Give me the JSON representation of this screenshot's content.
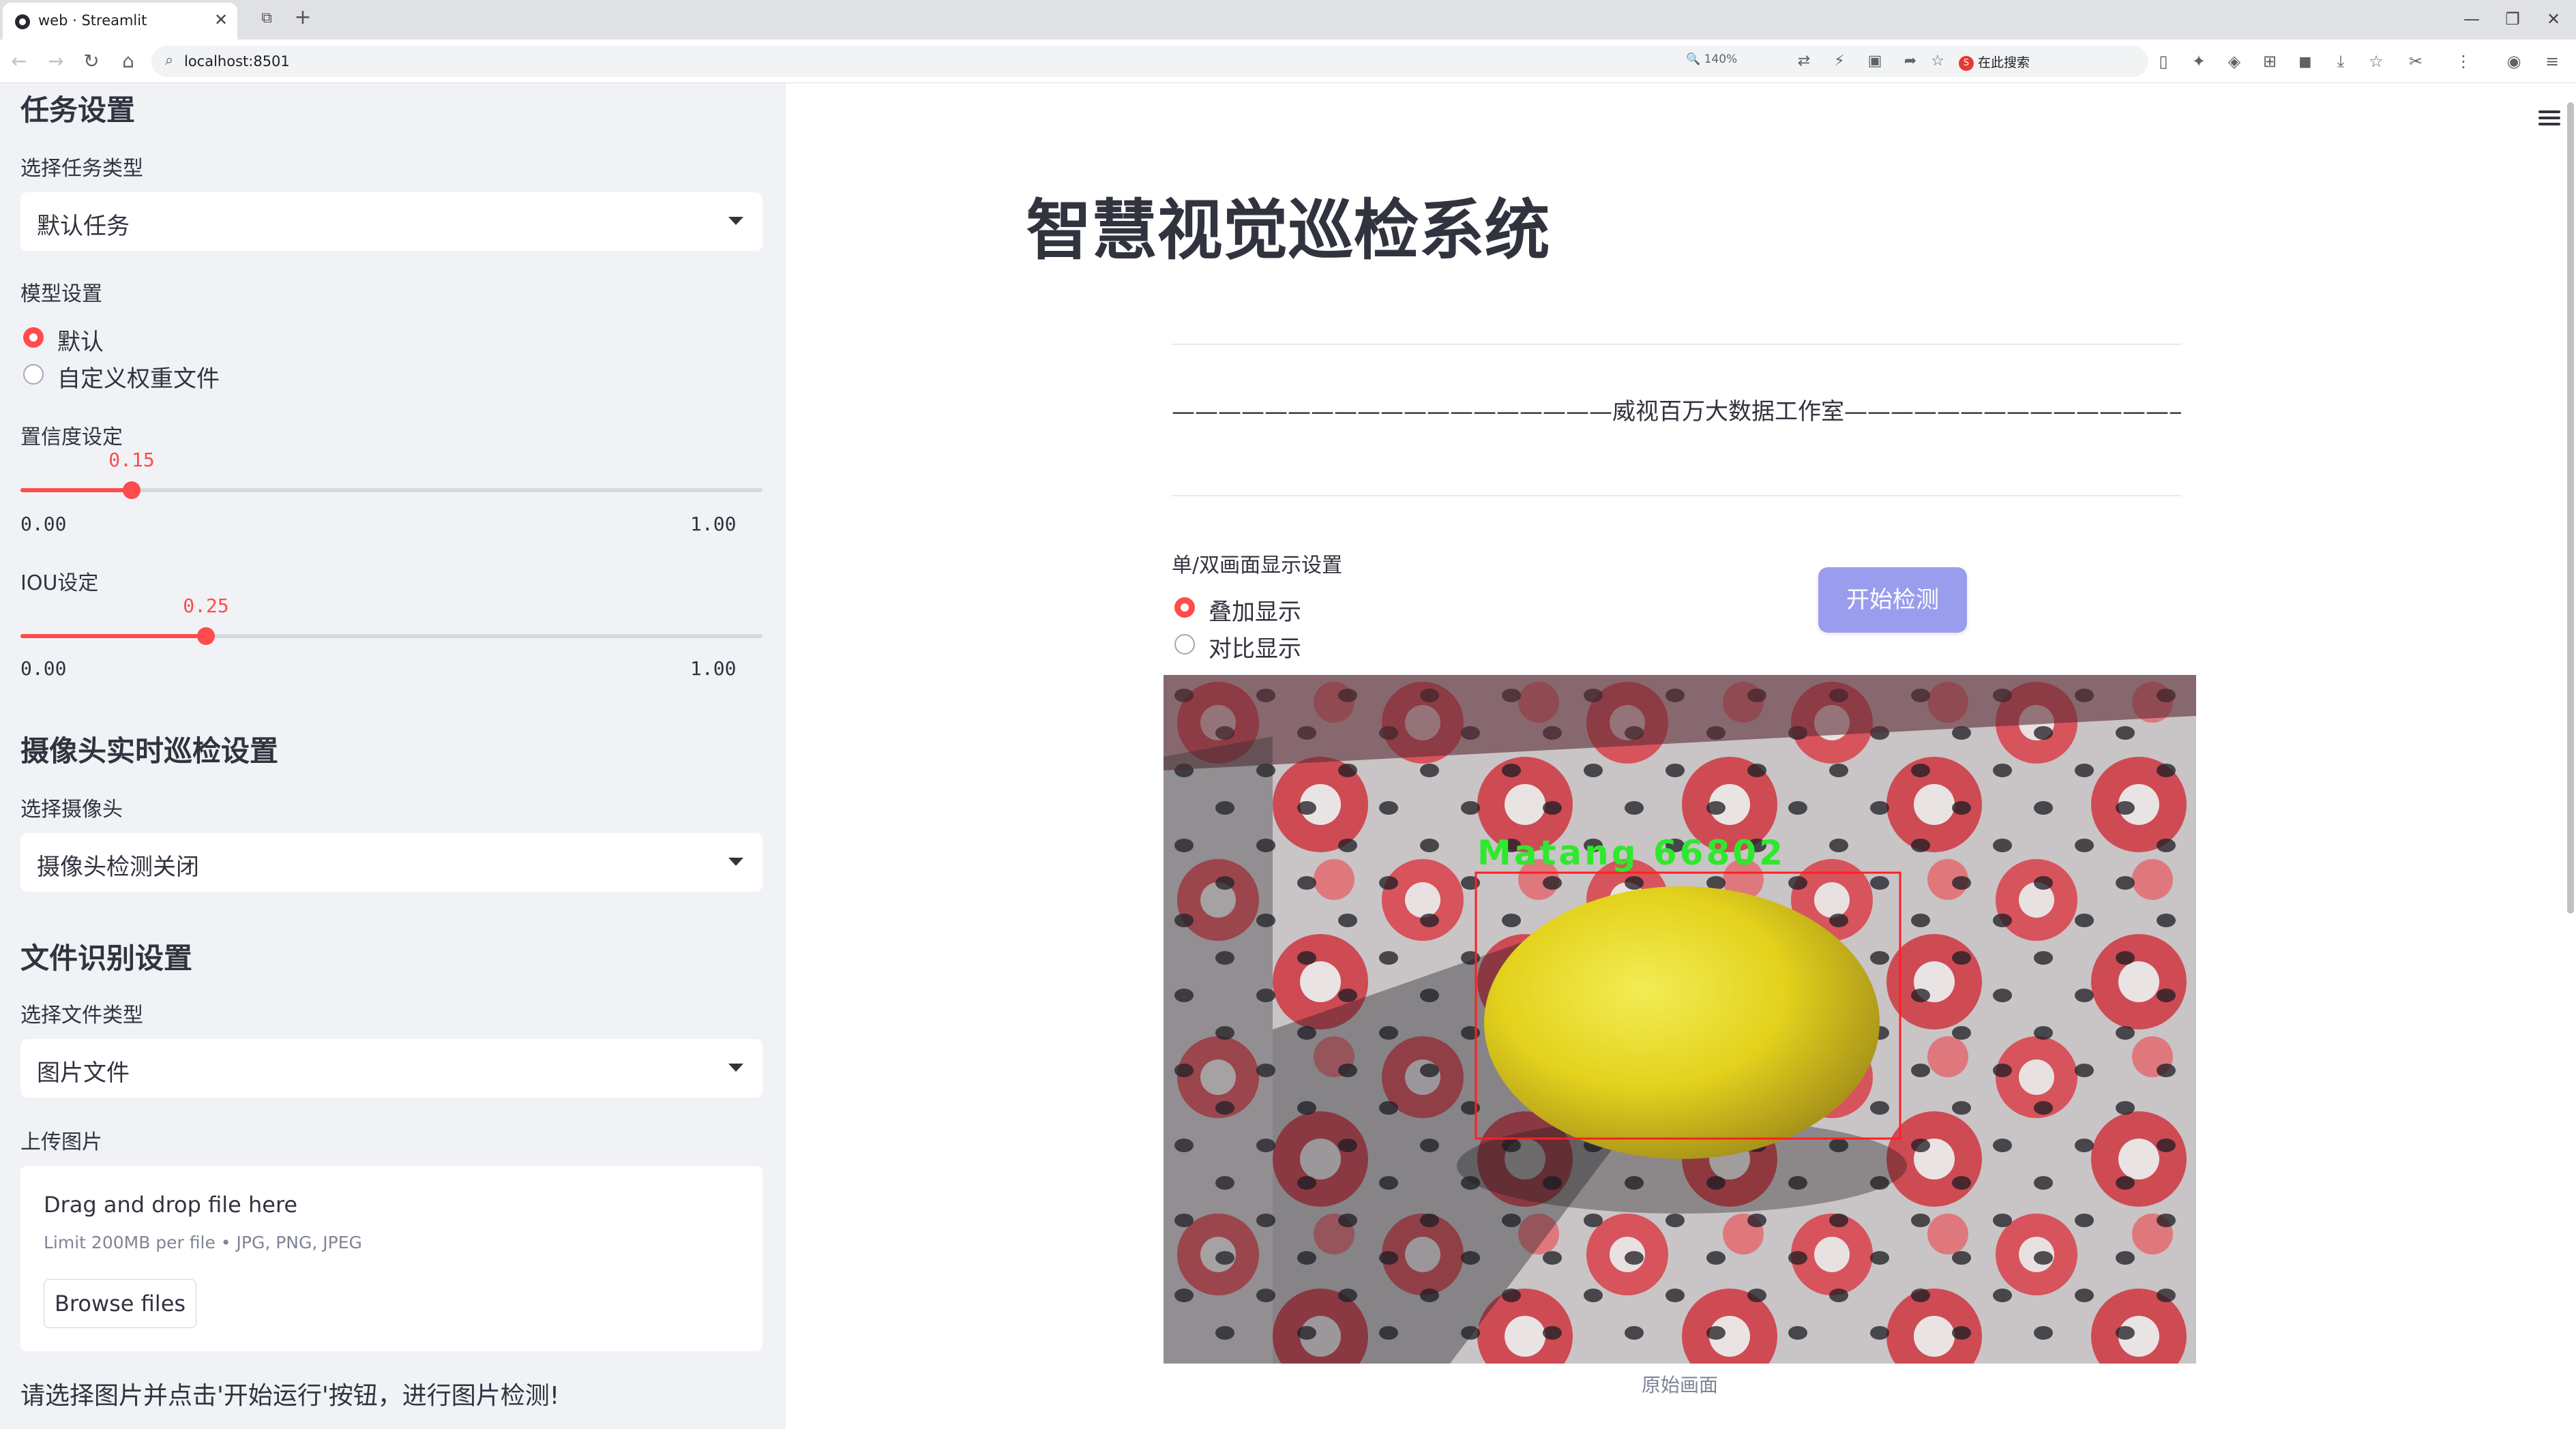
{
  "browser": {
    "tab_title": "web · Streamlit",
    "tab_close": "✕",
    "new_tab": "+",
    "url": "localhost:8501",
    "zoom": "140%",
    "search_provider_badge": "S",
    "search_provider": "在此搜索",
    "window_minimize": "—",
    "window_restore": "❐",
    "window_close": "✕"
  },
  "sidebar": {
    "task_section": {
      "heading": "任务设置",
      "select_label": "选择任务类型",
      "select_value": "默认任务"
    },
    "model_section": {
      "label": "模型设置",
      "options": [
        {
          "label": "默认",
          "selected": true
        },
        {
          "label": "自定义权重文件",
          "selected": false
        }
      ]
    },
    "confidence": {
      "label": "置信度设定",
      "value": 0.15,
      "value_text": "0.15",
      "min": "0.00",
      "max": "1.00"
    },
    "iou": {
      "label": "IOU设定",
      "value": 0.25,
      "value_text": "0.25",
      "min": "0.00",
      "max": "1.00"
    },
    "camera_section": {
      "heading": "摄像头实时巡检设置",
      "select_label": "选择摄像头",
      "select_value": "摄像头检测关闭"
    },
    "file_section": {
      "heading": "文件识别设置",
      "select_label": "选择文件类型",
      "select_value": "图片文件",
      "upload_label": "上传图片",
      "drop_text": "Drag and drop file here",
      "limit_text": "Limit 200MB per file • JPG, PNG, JPEG",
      "browse_label": "Browse files"
    },
    "hint": "请选择图片并点击'开始运行'按钮，进行图片检测!"
  },
  "main": {
    "title": "智慧视觉巡检系统",
    "studio_line": "———————————————————威视百万大数据工作室———————————————————",
    "display_label": "单/双画面显示设置",
    "display_options": [
      {
        "label": "叠加显示",
        "selected": true
      },
      {
        "label": "对比显示",
        "selected": false
      }
    ],
    "start_button": "开始检测",
    "detection_label": "Matang  66802",
    "caption": "原始画面"
  },
  "colors": {
    "accent": "#ff4b4b",
    "button": "#9a9ded",
    "sidebar_bg": "#f0f2f6",
    "detection_box": "#ff2020",
    "detection_text": "#2ee82e"
  }
}
